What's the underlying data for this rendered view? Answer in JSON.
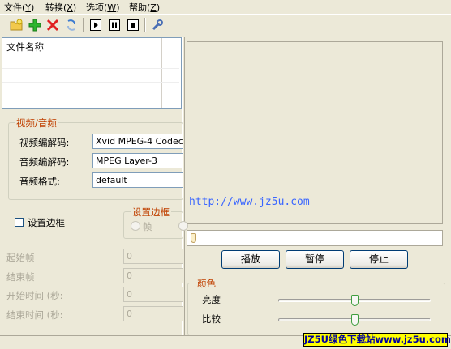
{
  "menu": [
    {
      "label": "文件(",
      "key": "Y",
      "suffix": ")"
    },
    {
      "label": "转换(",
      "key": "X",
      "suffix": ")"
    },
    {
      "label": "选项(",
      "key": "W",
      "suffix": ")"
    },
    {
      "label": "帮助(",
      "key": "Z",
      "suffix": ")"
    }
  ],
  "toolbar": {
    "icons": [
      "open-folder-icon",
      "add-icon",
      "delete-icon",
      "convert-icon",
      "play-icon",
      "pause-icon",
      "stop-icon",
      "settings-icon"
    ]
  },
  "filelist": {
    "column_header": "文件名称"
  },
  "video_audio": {
    "title": "视频/音频",
    "video_codec_label": "视频编解码:",
    "video_codec_value": "Xvid MPEG-4 Codec",
    "audio_codec_label": "音频编解码:",
    "audio_codec_value": "MPEG Layer-3",
    "audio_format_label": "音频格式:",
    "audio_format_value": "default"
  },
  "border": {
    "checkbox_label": "设置边框",
    "group_title": "设置边框",
    "radio_frame_label": "帧"
  },
  "range": {
    "start_frame_label": "起始帧",
    "start_frame_value": "0",
    "end_frame_label": "结束帧",
    "end_frame_value": "0",
    "start_time_label": "开始时间 (秒:",
    "start_time_value": "0",
    "end_time_label": "结束时间 (秒:",
    "end_time_value": "0"
  },
  "preview": {
    "watermark": "http://www.jz5u.com"
  },
  "playback": {
    "progress": 0,
    "play": "播放",
    "pause": "暂停",
    "stop": "停止"
  },
  "color": {
    "title": "颜色",
    "brightness_label": "亮度",
    "brightness_level": 0.5,
    "contrast_label": "比较",
    "contrast_level": 0.5
  },
  "logo_text": "JZ5U绿色下载站www.jz5u.com"
}
